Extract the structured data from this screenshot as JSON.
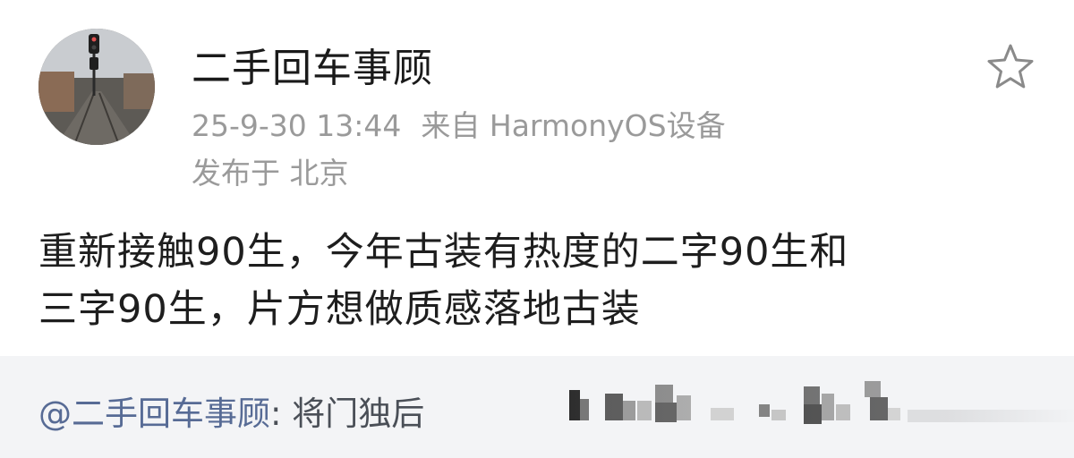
{
  "post": {
    "username": "二手回车事顾",
    "timestamp": "25-9-30 13:44",
    "source": "来自 HarmonyOS设备",
    "location": "发布于 北京",
    "content_lines": [
      "重新接触90生，今年古装有热度的二字90生和",
      "三字90生，片方想做质感落地古装"
    ]
  },
  "repost": {
    "mention": "@二手回车事顾",
    "separator": ": ",
    "text": "将门独后"
  },
  "icons": {
    "favorite": "star-outline-icon",
    "avatar": "railway-signal-photo"
  },
  "colors": {
    "username": "#1a1a1a",
    "meta": "#9a9a9a",
    "content": "#1e1e1e",
    "repost_bg": "#f3f4f6",
    "mention": "#576b95"
  }
}
